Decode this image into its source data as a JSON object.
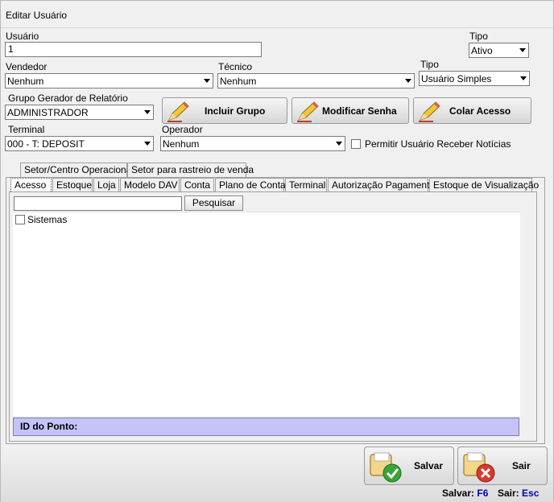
{
  "window": {
    "title": "Editar Usuário"
  },
  "form": {
    "usuario": {
      "label": "Usuário",
      "value": "1"
    },
    "tipo_status": {
      "label": "Tipo",
      "value": "Ativo"
    },
    "vendedor": {
      "label": "Vendedor",
      "value": "Nenhum"
    },
    "tecnico": {
      "label": "Técnico",
      "value": "Nenhum"
    },
    "tipo_usuario": {
      "label": "Tipo",
      "value": "Usuário Simples"
    },
    "grupo": {
      "label": "Grupo Gerador de Relatório",
      "value": "ADMINISTRADOR"
    },
    "terminal": {
      "label": "Terminal",
      "value": "000 - T: DEPOSIT"
    },
    "operador": {
      "label": "Operador",
      "value": "Nenhum"
    },
    "noticias": {
      "label": "Permitir Usuário Receber Notícias",
      "checked": false
    }
  },
  "buttons": {
    "incluir_grupo": "Incluir Grupo",
    "modificar_senha": "Modificar Senha",
    "colar_acesso": "Colar Acesso",
    "salvar": "Salvar",
    "sair": "Sair"
  },
  "top_tabs": [
    "Setor/Centro Operacional",
    "Setor para rastreio de venda"
  ],
  "tabs": [
    "Acesso",
    "Estoque",
    "Loja",
    "Modelo DAV",
    "Conta",
    "Plano de Conta",
    "Terminal",
    "Autorização Pagamento",
    "Estoque de Visualização"
  ],
  "active_tab": "Acesso",
  "search": {
    "value": "",
    "button": "Pesquisar"
  },
  "tree": {
    "items": [
      {
        "label": "Sistemas",
        "checked": false
      }
    ]
  },
  "id_bar": {
    "label": "ID do Ponto:"
  },
  "hotkeys": {
    "salvar_label": "Salvar:",
    "salvar_key": "F6",
    "sair_label": "Sair:",
    "sair_key": "Esc"
  },
  "icons": {
    "action_buttons": "pencil-icon",
    "salvar": "save-check-icon",
    "sair": "exit-cancel-icon"
  },
  "colors": {
    "id_bar_bg": "#c4c4f9",
    "hotkey": "#0000c0"
  }
}
